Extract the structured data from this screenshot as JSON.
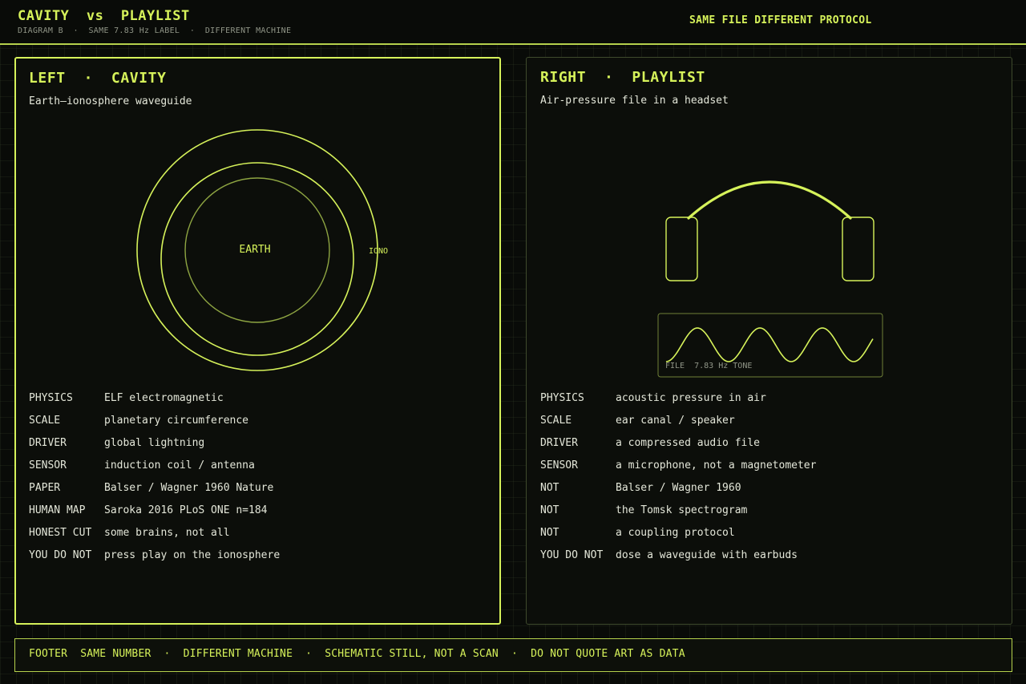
{
  "header": {
    "title": "CAVITY  vs  PLAYLIST",
    "subtitle": "DIAGRAM B  ·  SAME 7.83 Hz LABEL  ·  DIFFERENT MACHINE",
    "tag": "SAME FILE DIFFERENT PROTOCOL"
  },
  "left": {
    "title": "LEFT  ·  CAVITY",
    "subtitle": "Earth–ionosphere waveguide",
    "earth_label": "EARTH",
    "iono_label": "IONO",
    "facts": [
      {
        "key": "PHYSICS",
        "value": "ELF electromagnetic"
      },
      {
        "key": "SCALE",
        "value": "planetary circumference"
      },
      {
        "key": "DRIVER",
        "value": "global lightning"
      },
      {
        "key": "SENSOR",
        "value": "induction coil / antenna"
      },
      {
        "key": "PAPER",
        "value": "Balser / Wagner 1960 Nature"
      },
      {
        "key": "HUMAN MAP",
        "value": "Saroka 2016 PLoS ONE n=184"
      },
      {
        "key": "HONEST CUT",
        "value": "some brains, not all"
      },
      {
        "key": "YOU DO NOT",
        "value": "press play on the ionosphere"
      }
    ]
  },
  "right": {
    "title": "RIGHT  ·  PLAYLIST",
    "subtitle": "Air-pressure file in a headset",
    "wave_label": "FILE  7.83 Hz TONE",
    "facts": [
      {
        "key": "PHYSICS",
        "value": "acoustic pressure in air"
      },
      {
        "key": "SCALE",
        "value": "ear canal / speaker"
      },
      {
        "key": "DRIVER",
        "value": "a compressed audio file"
      },
      {
        "key": "SENSOR",
        "value": "a microphone, not a magnetometer"
      },
      {
        "key": "NOT",
        "value": "Balser / Wagner 1960"
      },
      {
        "key": "NOT",
        "value": "the Tomsk spectrogram"
      },
      {
        "key": "NOT",
        "value": "a coupling protocol"
      },
      {
        "key": "YOU DO NOT",
        "value": "dose a waveguide with earbuds"
      }
    ]
  },
  "footer": {
    "text": "FOOTER  SAME NUMBER  ·  DIFFERENT MACHINE  ·  SCHEMATIC STILL, NOT A SCAN  ·  DO NOT QUOTE ART AS DATA"
  },
  "colors": {
    "accent": "#d6f25a",
    "accent_dim": "#b5d14c",
    "background": "#090b08",
    "panel": "#0c0e0a",
    "text": "#e4e7d9",
    "muted": "#8f9486"
  }
}
